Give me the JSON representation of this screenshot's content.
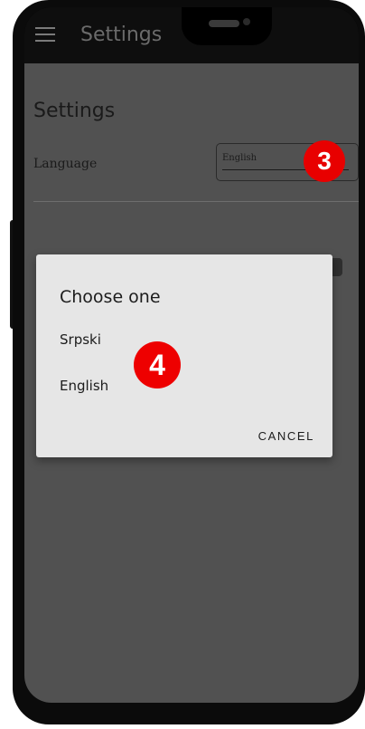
{
  "app_bar": {
    "title": "Settings"
  },
  "page": {
    "heading": "Settings"
  },
  "language_setting": {
    "label": "Language",
    "current_value": "English"
  },
  "dialog": {
    "title": "Choose one",
    "options": [
      {
        "label": "Srpski"
      },
      {
        "label": "English"
      }
    ],
    "cancel_label": "CANCEL"
  },
  "step_badges": [
    "3",
    "4"
  ],
  "colors": {
    "badge": "#ee0000",
    "dialog_bg": "#e6e6e6",
    "scrim": "#515151"
  }
}
